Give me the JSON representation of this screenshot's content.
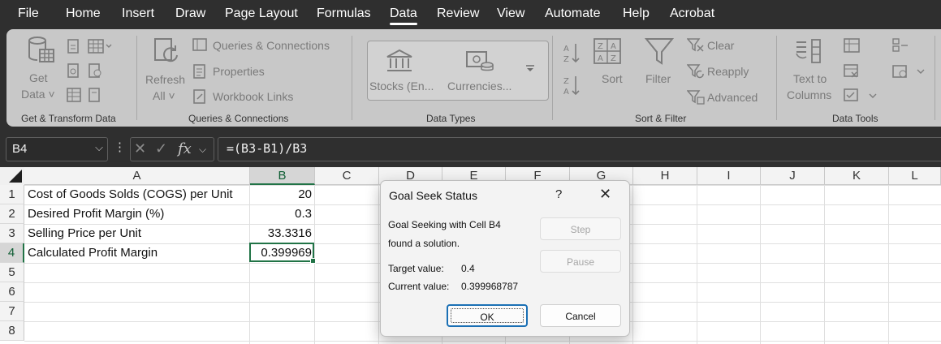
{
  "menu": {
    "tabs": [
      "File",
      "Home",
      "Insert",
      "Draw",
      "Page Layout",
      "Formulas",
      "Data",
      "Review",
      "View",
      "Automate",
      "Help",
      "Acrobat"
    ],
    "active": "Data"
  },
  "ribbon": {
    "get_transform": {
      "get_data_l1": "Get",
      "get_data_l2": "Data ˅",
      "group_label": "Get & Transform Data"
    },
    "queries": {
      "refresh_l1": "Refresh",
      "refresh_l2": "All ˅",
      "queries_connections": "Queries & Connections",
      "properties": "Properties",
      "workbook_links": "Workbook Links",
      "group_label": "Queries & Connections"
    },
    "data_types": {
      "stocks": "Stocks (En...",
      "currencies": "Currencies...",
      "group_label": "Data Types"
    },
    "sort_filter": {
      "sort": "Sort",
      "filter": "Filter",
      "clear": "Clear",
      "reapply": "Reapply",
      "advanced": "Advanced",
      "group_label": "Sort & Filter"
    },
    "data_tools": {
      "text_to_l1": "Text to",
      "text_to_l2": "Columns",
      "group_label": "Data Tools"
    }
  },
  "formula_bar": {
    "name_box": "B4",
    "fx": "fx",
    "formula": "=(B3-B1)/B3"
  },
  "grid": {
    "columns": [
      "A",
      "B",
      "C",
      "D",
      "E",
      "F",
      "G",
      "H",
      "I",
      "J",
      "K",
      "L"
    ],
    "rows": [
      "1",
      "2",
      "3",
      "4",
      "5",
      "6",
      "7",
      "8"
    ],
    "cells": {
      "A1": "Cost of Goods Solds (COGS) per Unit",
      "B1": "20",
      "A2": "Desired Profit Margin (%)",
      "B2": "0.3",
      "A3": "Selling Price per Unit",
      "B3": "33.3316",
      "A4": "Calculated Profit Margin",
      "B4": "0.399969"
    },
    "active_cell": "B4"
  },
  "dialog": {
    "title": "Goal Seek Status",
    "help": "?",
    "close": "✕",
    "message_l1": "Goal Seeking with Cell B4",
    "message_l2": "found a solution.",
    "target_label": "Target value:",
    "target_value": "0.4",
    "current_label": "Current value:",
    "current_value": "0.399968787",
    "step": "Step",
    "pause": "Pause",
    "ok": "OK",
    "cancel": "Cancel"
  },
  "colors": {
    "menu_bg": "#2f2f2f",
    "ribbon_bg": "#c8c8c8",
    "accent_green": "#217346",
    "dialog_primary": "#1a6fb4"
  }
}
